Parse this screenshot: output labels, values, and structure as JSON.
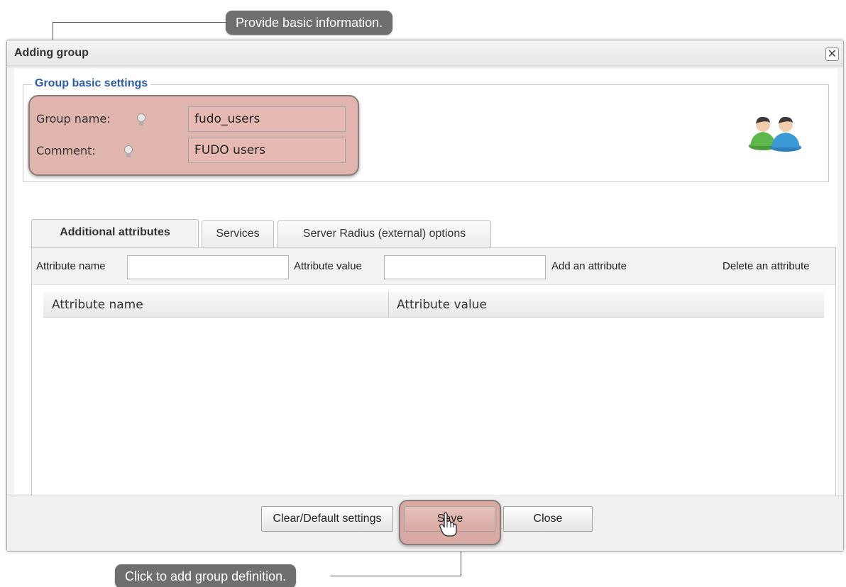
{
  "callouts": {
    "top": "Provide basic information.",
    "bottom": "Click to add group definition."
  },
  "dialog": {
    "title": "Adding group",
    "close_glyph": "✕"
  },
  "basic_settings": {
    "legend": "Group basic settings",
    "group_name_label": "Group name:",
    "group_name_value": "fudo_users",
    "comment_label": "Comment:",
    "comment_value": "FUDO users",
    "icon": "users-icon"
  },
  "tabs": [
    {
      "label": "Additional attributes",
      "active": true
    },
    {
      "label": "Services",
      "active": false
    },
    {
      "label": "Server Radius (external) options",
      "active": false
    }
  ],
  "attributes": {
    "name_label": "Attribute name",
    "value_label": "Attribute value",
    "add_label": "Add an attribute",
    "delete_label": "Delete an attribute",
    "columns": [
      "Attribute name",
      "Attribute value"
    ]
  },
  "footer": {
    "clear_label": "Clear/Default settings",
    "save_label": "Save",
    "close_label": "Close"
  },
  "colors": {
    "legend": "#2a5da8",
    "highlight": "#e0b5ae",
    "callout": "#6f6f6f"
  }
}
